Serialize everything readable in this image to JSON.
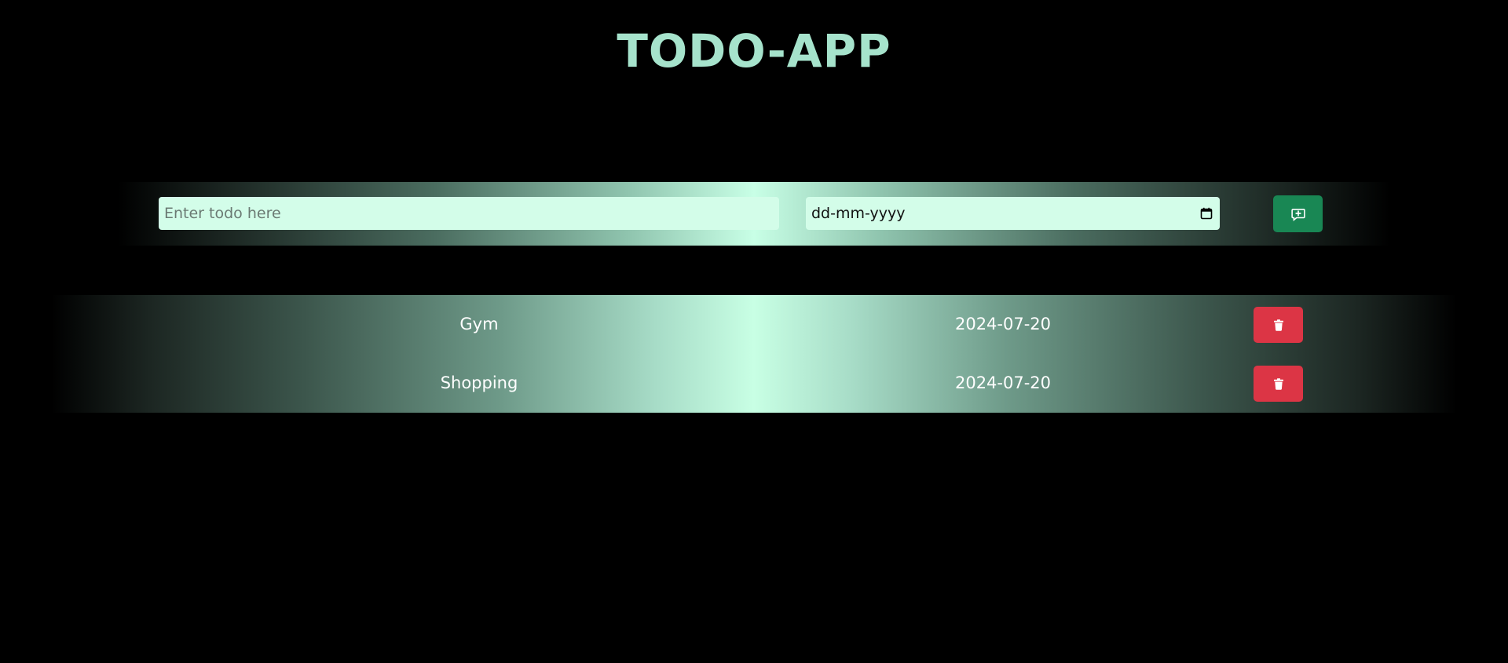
{
  "header": {
    "title": "TODO-APP"
  },
  "form": {
    "todo_placeholder": "Enter todo here",
    "date_placeholder": "dd-mm-yyyy",
    "add_icon": "message-plus-icon",
    "calendar_icon": "calendar-icon"
  },
  "todos": [
    {
      "name": "Gym",
      "date": "2024-07-20",
      "delete_icon": "trash-icon"
    },
    {
      "name": "Shopping",
      "date": "2024-07-20",
      "delete_icon": "trash-icon"
    }
  ],
  "colors": {
    "background": "#000000",
    "title": "#a6e3cc",
    "field": "#d3fde9",
    "add_button": "#198754",
    "delete_button": "#dc3545",
    "band_center": "#c8ffe6"
  }
}
